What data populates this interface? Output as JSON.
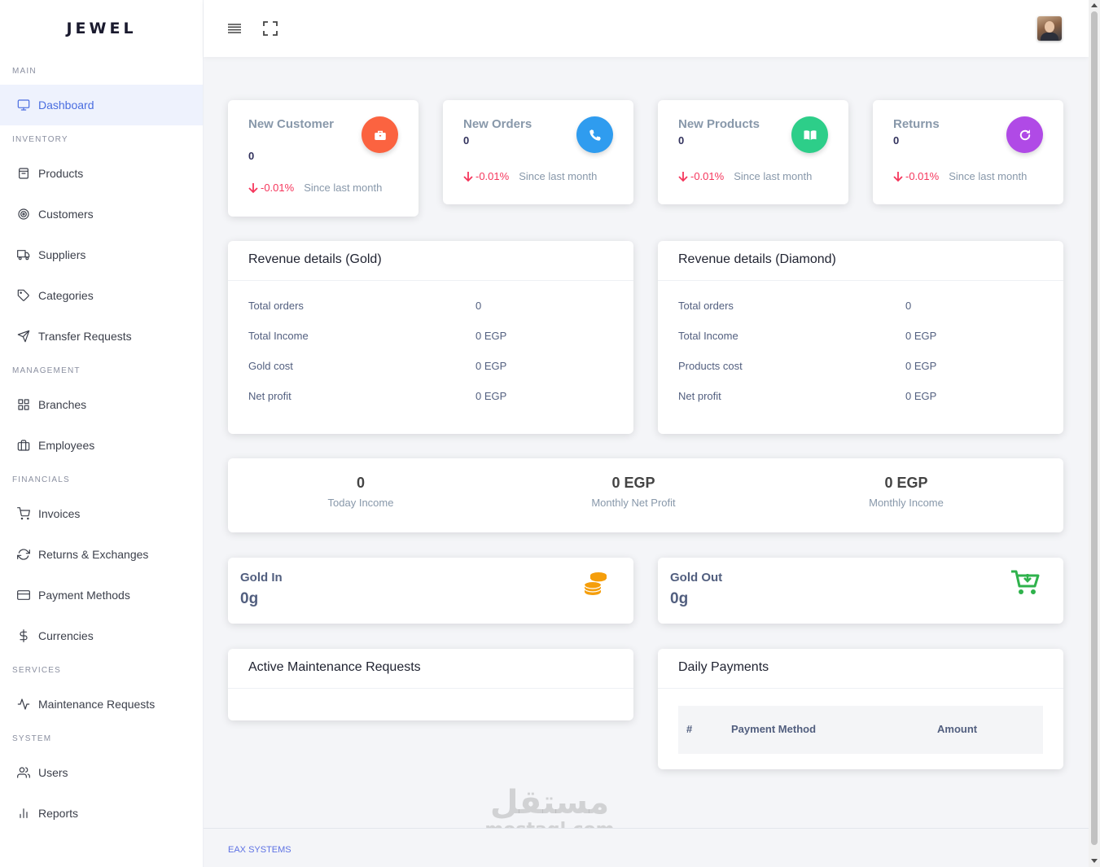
{
  "brand": "JEWEL",
  "sidebar": {
    "sections": [
      {
        "label": "MAIN",
        "items": [
          {
            "label": "Dashboard",
            "icon": "monitor-icon",
            "active": true
          }
        ]
      },
      {
        "label": "INVENTORY",
        "items": [
          {
            "label": "Products",
            "icon": "box-icon"
          },
          {
            "label": "Customers",
            "icon": "target-icon"
          },
          {
            "label": "Suppliers",
            "icon": "truck-icon"
          },
          {
            "label": "Categories",
            "icon": "tag-icon"
          },
          {
            "label": "Transfer Requests",
            "icon": "send-icon"
          }
        ]
      },
      {
        "label": "MANAGEMENT",
        "items": [
          {
            "label": "Branches",
            "icon": "grid-icon"
          },
          {
            "label": "Employees",
            "icon": "briefcase-icon"
          }
        ]
      },
      {
        "label": "FINANCIALS",
        "items": [
          {
            "label": "Invoices",
            "icon": "cart-icon"
          },
          {
            "label": "Returns & Exchanges",
            "icon": "refresh-icon"
          },
          {
            "label": "Payment Methods",
            "icon": "credit-card-icon"
          },
          {
            "label": "Currencies",
            "icon": "dollar-icon"
          }
        ]
      },
      {
        "label": "SERVICES",
        "items": [
          {
            "label": "Maintenance Requests",
            "icon": "activity-icon"
          }
        ]
      },
      {
        "label": "SYSTEM",
        "items": [
          {
            "label": "Users",
            "icon": "users-icon"
          },
          {
            "label": "Reports",
            "icon": "bar-chart-icon"
          }
        ]
      }
    ]
  },
  "stats": [
    {
      "title": "New Customer",
      "value": "0",
      "change": "-0.01%",
      "since": "Since last month",
      "color": "#fb6340",
      "icon": "briefcase-icon"
    },
    {
      "title": "New Orders",
      "value": "0",
      "change": "-0.01%",
      "since": "Since last month",
      "color": "#2f9cef",
      "icon": "phone-icon"
    },
    {
      "title": "New Products",
      "value": "0",
      "change": "-0.01%",
      "since": "Since last month",
      "color": "#2dce89",
      "icon": "book-icon"
    },
    {
      "title": "Returns",
      "value": "0",
      "change": "-0.01%",
      "since": "Since last month",
      "color": "#b04ae6",
      "icon": "redo-icon"
    }
  ],
  "revenue_gold": {
    "title": "Revenue details (Gold)",
    "rows": [
      {
        "label": "Total orders",
        "value": "0"
      },
      {
        "label": "Total Income",
        "value": "0 EGP"
      },
      {
        "label": "Gold cost",
        "value": "0 EGP"
      },
      {
        "label": "Net profit",
        "value": "0 EGP"
      }
    ]
  },
  "revenue_diamond": {
    "title": "Revenue details (Diamond)",
    "rows": [
      {
        "label": "Total orders",
        "value": "0"
      },
      {
        "label": "Total Income",
        "value": "0 EGP"
      },
      {
        "label": "Products cost",
        "value": "0 EGP"
      },
      {
        "label": "Net profit",
        "value": "0 EGP"
      }
    ]
  },
  "summary": [
    {
      "value": "0",
      "label": "Today Income"
    },
    {
      "value": "0 EGP",
      "label": "Monthly Net Profit"
    },
    {
      "value": "0 EGP",
      "label": "Monthly Income"
    }
  ],
  "gold_in": {
    "label": "Gold In",
    "value": "0g",
    "icon": "coins-icon",
    "color": "#f59e0b"
  },
  "gold_out": {
    "label": "Gold Out",
    "value": "0g",
    "icon": "cart-download-icon",
    "color": "#2fb24c"
  },
  "maintenance": {
    "title": "Active Maintenance Requests"
  },
  "daily_payments": {
    "title": "Daily Payments",
    "columns": [
      "#",
      "Payment Method",
      "Amount"
    ]
  },
  "footer": {
    "text": "EAX SYSTEMS"
  },
  "watermark": {
    "arabic": "مستقل",
    "latin": "mostaql.com"
  },
  "colors": {
    "accent": "#5e72e4",
    "negative": "#f5365c",
    "muted": "#8898aa"
  }
}
